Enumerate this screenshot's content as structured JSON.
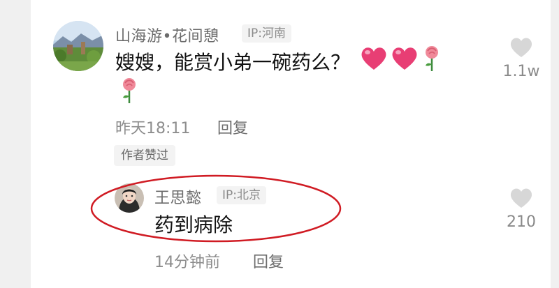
{
  "comment": {
    "username": "山海游•花间憩",
    "ip": "IP:河南",
    "text": "嫂嫂，能赏小弟一碗药么？",
    "emojis": [
      "heart-emoji",
      "heart-emoji",
      "rose-emoji",
      "rose-emoji"
    ],
    "time": "昨天18:11",
    "reply_label": "回复",
    "author_liked": "作者赞过",
    "like_count": "1.1w",
    "like_icon": "heart-outline-icon"
  },
  "reply": {
    "username": "王思懿",
    "ip": "IP:北京",
    "text": "药到病除",
    "time": "14分钟前",
    "reply_label": "回复",
    "like_count": "210",
    "like_icon": "heart-outline-icon"
  },
  "colors": {
    "highlight": "#d01b23",
    "emoji_heart": "#e83e74",
    "like_icon": "#d7d7d7"
  }
}
